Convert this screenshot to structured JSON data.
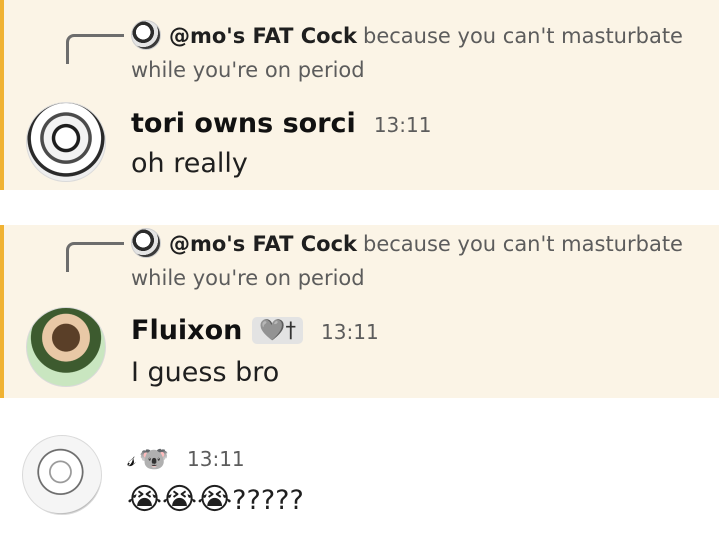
{
  "messages": [
    {
      "reply": {
        "author": "@mo's FAT Cock",
        "text_line1": "because you can't masturbate",
        "text_line2": "while you're on period"
      },
      "author": "tori owns sorci",
      "time": "13:11",
      "content": "oh really"
    },
    {
      "reply": {
        "author": "@mo's FAT Cock",
        "text_line1": "because you can't masturbate",
        "text_line2": "while you're on period"
      },
      "author": "Fluixon",
      "role_tag": "🩶†",
      "time": "13:11",
      "content": "I guess bro"
    },
    {
      "author_glyph": "𝓈",
      "author_emoji": "🐨",
      "time": "13:11",
      "content_emojis": "😭😭😭",
      "content_text": "?????"
    }
  ],
  "colors": {
    "mention_bg": "#fbf4e6",
    "mention_bar": "#f0b232"
  }
}
